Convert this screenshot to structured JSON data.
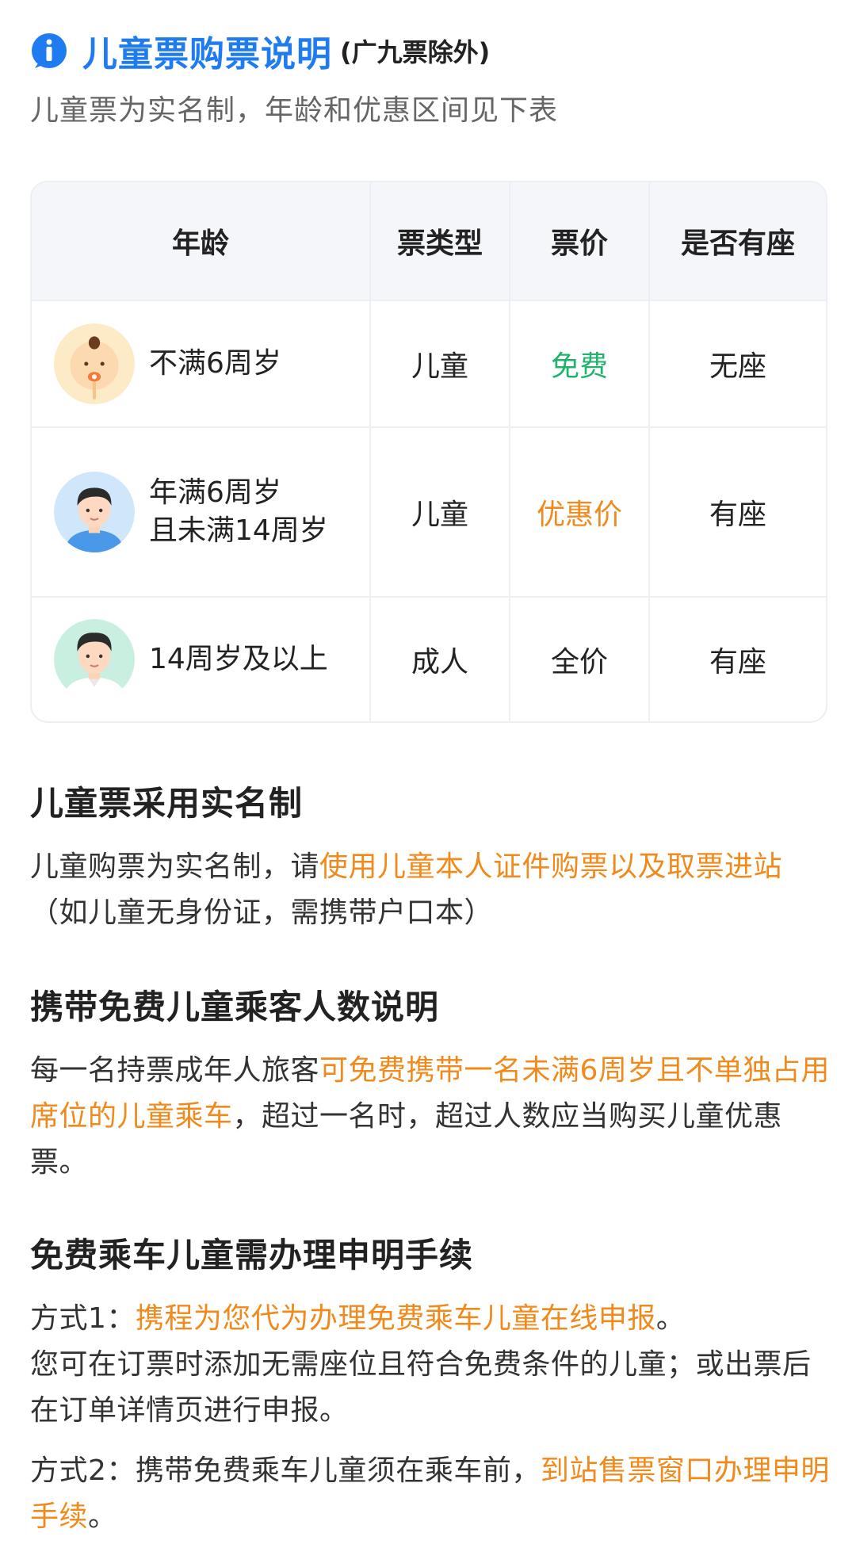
{
  "header": {
    "title": "儿童票购票说明",
    "title_note": "(广九票除外)",
    "subtitle": "儿童票为实名制，年龄和优惠区间见下表"
  },
  "table": {
    "headers": [
      "年龄",
      "票类型",
      "票价",
      "是否有座"
    ],
    "rows": [
      {
        "age_line1": "不满6周岁",
        "age_line2": "",
        "type": "儿童",
        "price": "免费",
        "seat": "无座",
        "avatar": "baby-avatar-icon"
      },
      {
        "age_line1": "年满6周岁",
        "age_line2": "且未满14周岁",
        "type": "儿童",
        "price": "优惠价",
        "seat": "有座",
        "avatar": "child-avatar-icon"
      },
      {
        "age_line1": "14周岁及以上",
        "age_line2": "",
        "type": "成人",
        "price": "全价",
        "seat": "有座",
        "avatar": "adult-avatar-icon"
      }
    ]
  },
  "sections": {
    "realname": {
      "title": "儿童票采用实名制",
      "t1": "儿童购票为实名制，请",
      "h1": "使用儿童本人证件购票以及取票进站",
      "t2": "（如儿童无身份证，需携带户口本）"
    },
    "free_child": {
      "title": "携带免费儿童乘客人数说明",
      "t1": "每一名持票成年人旅客",
      "h1": "可免费携带一名未满6周岁且不单独占用席位的儿童乘车",
      "t2": "，超过一名时，超过人数应当购买儿童优惠票。"
    },
    "declare": {
      "title": "免费乘车儿童需办理申明手续",
      "m1_t1": "方式1：",
      "m1_h1": "携程为您代为办理免费乘车儿童在线申报",
      "m1_t2": "。",
      "m1_t3": "您可在订票时添加无需座位且符合免费条件的儿童；或出票后在订单详情页进行申报。",
      "m2_t1": "方式2：携带免费乘车儿童须在乘车前，",
      "m2_h1": "到站售票窗口办理申明手续",
      "m2_t2": "。"
    }
  },
  "colors": {
    "accent_blue": "#1f7cf0",
    "highlight_orange": "#f08a1c",
    "free_green": "#1fb36b"
  }
}
